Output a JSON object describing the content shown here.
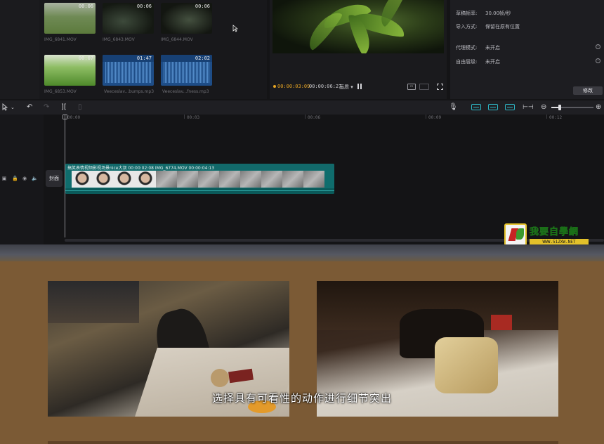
{
  "media": {
    "clips": [
      {
        "name": "IMG_6841.MOV",
        "duration": "00:06"
      },
      {
        "name": "",
        "duration": "00:06"
      },
      {
        "name": "IMG_6844.MOV",
        "duration": "00:06"
      },
      {
        "name": "IMG_6853.MOV",
        "duration": "00:07"
      },
      {
        "name": "Veeceslav...bumps.mp3",
        "duration": "01:47"
      },
      {
        "name": "Veeceslav...fness.mp3",
        "duration": "02:02"
      }
    ],
    "second_label": "IMG_6843.MOV"
  },
  "player": {
    "current_time": "00:00:03:09",
    "total_time": "00:00:06:27",
    "quality": "画质"
  },
  "properties": {
    "rows": [
      {
        "label": "草稿帧率:",
        "value": "30.00帧/秒"
      },
      {
        "label": "导入方式:",
        "value": "保留在原有位置"
      },
      {
        "label": "代理模式:",
        "value": "未开启"
      },
      {
        "label": "自由层级:",
        "value": "未开启"
      }
    ],
    "modify_label": "修改"
  },
  "timeline": {
    "ruler": [
      "00:00",
      "00:03",
      "00:06",
      "00:09",
      "00:12"
    ],
    "cover_label": "封面",
    "clip_title": "搞笑表情视频影视场景nice大叔   00:00:02:08  IMG_6774.MOV   00:00:04:13"
  },
  "watermark": {
    "cn": "我要自學網",
    "url": "WWW.51ZXW.NET"
  },
  "slide": {
    "subtitle": "选择具有可看性的动作进行细节突出"
  },
  "colors": {
    "accent": "#2db6c5",
    "time_accent": "#e6a423",
    "clip": "#0f6d6d",
    "slide_bg": "#7b5a35"
  }
}
